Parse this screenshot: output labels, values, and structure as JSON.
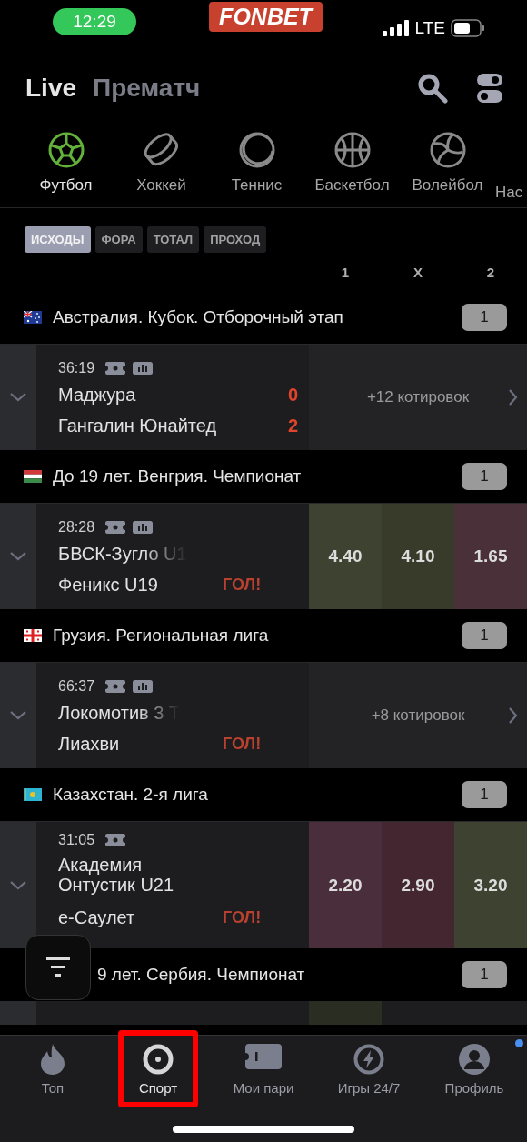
{
  "status_bar": {
    "time": "12:29",
    "network": "LTE"
  },
  "logo": "FONBET",
  "modes": [
    {
      "label": "Live",
      "selected": true
    },
    {
      "label": "Прематч",
      "selected": false
    }
  ],
  "sports": [
    {
      "kind": "football",
      "label": "Футбол",
      "selected": true
    },
    {
      "kind": "hockey",
      "label": "Хоккей",
      "selected": false
    },
    {
      "kind": "tennis",
      "label": "Теннис",
      "selected": false
    },
    {
      "kind": "basketball",
      "label": "Баскетбол",
      "selected": false
    },
    {
      "kind": "volleyball",
      "label": "Волейбол",
      "selected": false
    },
    {
      "kind": "cut",
      "label": "Нас",
      "selected": false
    }
  ],
  "markets": [
    {
      "label": "ИСХОДЫ",
      "selected": true
    },
    {
      "label": "ФОРА",
      "selected": false
    },
    {
      "label": "ТОТАЛ",
      "selected": false
    },
    {
      "label": "ПРОХОД",
      "selected": false
    }
  ],
  "columns": [
    "1",
    "X",
    "2"
  ],
  "leagues": [
    {
      "kind": "au",
      "name": "Австралия. Кубок. Отборочный этап",
      "count": "1",
      "covered": false,
      "matches": [
        {
          "time": "36:19",
          "stats": true,
          "teams": [
            {
              "name": "Маджура",
              "score": "0",
              "faded": false
            },
            {
              "name": "Гангалин Юнайтед",
              "score": "2",
              "faded": false
            }
          ],
          "quotes": "+12 котировок"
        }
      ]
    },
    {
      "kind": "hu",
      "name": "До 19 лет. Венгрия. Чемпионат",
      "count": "1",
      "covered": false,
      "matches": [
        {
          "time": "28:28",
          "stats": true,
          "teams": [
            {
              "name": "БВСК-Зугло U1",
              "faded": true
            },
            {
              "name": "Феникс U19",
              "faded": false
            }
          ],
          "goal": "ГОЛ!",
          "odds": [
            {
              "value": "4.40",
              "color": "#3d4330"
            },
            {
              "value": "4.10",
              "color": "#383b2a"
            },
            {
              "value": "1.65",
              "color": "#4a3038"
            }
          ]
        }
      ]
    },
    {
      "kind": "ge",
      "name": "Грузия. Региональная лига",
      "count": "1",
      "covered": false,
      "matches": [
        {
          "time": "66:37",
          "stats": true,
          "teams": [
            {
              "name": "Локомотив 3 Т",
              "faded": true
            },
            {
              "name": "Лиахви",
              "faded": false
            }
          ],
          "goal": "ГОЛ!",
          "quotes": "+8 котировок"
        }
      ]
    },
    {
      "kind": "kz",
      "name": "Казахстан. 2-я лига",
      "count": "1",
      "covered": false,
      "matches": [
        {
          "time": "31:05",
          "stats": false,
          "teams": [
            {
              "name": "Академия Онтустик U21",
              "faded": false
            },
            {
              "name": "е-Саулет",
              "faded": false
            }
          ],
          "goal": "ГОЛ!",
          "odds": [
            {
              "value": "2.20",
              "color": "#4a2e3b"
            },
            {
              "value": "2.90",
              "color": "#43262f"
            },
            {
              "value": "3.20",
              "color": "#3d4330"
            }
          ]
        }
      ]
    },
    {
      "name": "9 лет. Сербия. Чемпионат",
      "count": "1",
      "covered": true
    }
  ],
  "nav": [
    {
      "kind": "flame",
      "label": "Топ",
      "selected": false,
      "badge": false
    },
    {
      "kind": "target",
      "label": "Спорт",
      "selected": true,
      "badge": false
    },
    {
      "kind": "ticket",
      "label": "Мои пари",
      "selected": false,
      "badge": false
    },
    {
      "kind": "bolt",
      "label": "Игры 24/7",
      "selected": false,
      "badge": false
    },
    {
      "kind": "person",
      "label": "Профиль",
      "selected": false,
      "badge": true
    }
  ]
}
